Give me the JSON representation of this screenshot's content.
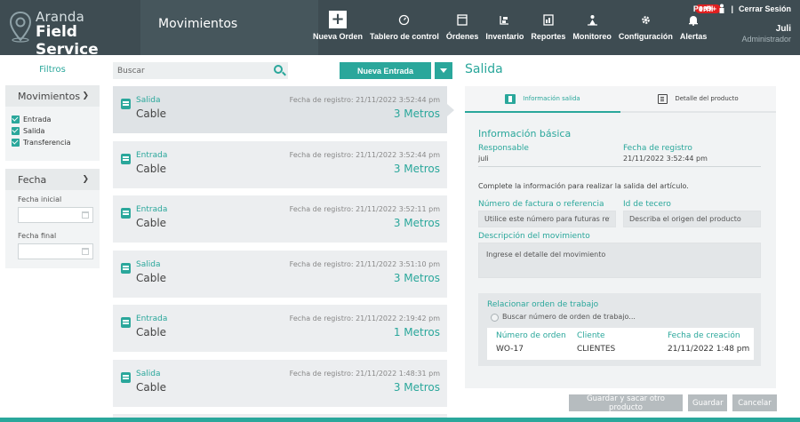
{
  "brand": {
    "line1": "Aranda",
    "line2": "Field Service",
    "accent": "#2aa79b",
    "header_bg": "#3e4c52"
  },
  "module": {
    "title": "Movimientos"
  },
  "nav": [
    {
      "label": "Nueva Orden",
      "icon": "plus-icon"
    },
    {
      "label": "Tablero de control",
      "icon": "dashboard-icon"
    },
    {
      "label": "Órdenes",
      "icon": "orders-icon"
    },
    {
      "label": "Inventario",
      "icon": "inventory-icon"
    },
    {
      "label": "Reportes",
      "icon": "reports-icon"
    },
    {
      "label": "Monitoreo",
      "icon": "monitor-icon"
    },
    {
      "label": "Configuración",
      "icon": "gear-icon"
    },
    {
      "label": "Alertas",
      "icon": "bell-icon",
      "badge": "999+"
    }
  ],
  "user": {
    "profile_label": "Perfil",
    "logout_label": "Cerrar Sesión",
    "name": "Juli",
    "role": "Administrador"
  },
  "filters": {
    "title": "Filtros",
    "movements_label": "Movimientos",
    "options": [
      "Entrada",
      "Salida",
      "Transferencia"
    ],
    "date_label": "Fecha",
    "start_label": "Fecha inicial",
    "end_label": "Fecha final"
  },
  "search": {
    "placeholder": "Buscar"
  },
  "new_entry_label": "Nueva Entrada",
  "list": [
    {
      "type": "Salida",
      "name": "Cable",
      "date": "Fecha de registro: 21/11/2022 3:52:44 pm",
      "qty": "3 Metros"
    },
    {
      "type": "Entrada",
      "name": "Cable",
      "date": "Fecha de registro: 21/11/2022 3:52:44 pm",
      "qty": "3 Metros"
    },
    {
      "type": "Entrada",
      "name": "Cable",
      "date": "Fecha de registro: 21/11/2022 3:52:11 pm",
      "qty": "3 Metros"
    },
    {
      "type": "Salida",
      "name": "Cable",
      "date": "Fecha de registro: 21/11/2022 3:51:10 pm",
      "qty": "3 Metros"
    },
    {
      "type": "Entrada",
      "name": "Cable",
      "date": "Fecha de registro: 21/11/2022 2:19:42 pm",
      "qty": "1 Metros"
    },
    {
      "type": "Salida",
      "name": "Cable",
      "date": "Fecha de registro: 21/11/2022 1:48:31 pm",
      "qty": "3 Metros"
    }
  ],
  "detail": {
    "title": "Salida",
    "tabs": [
      "Información salida",
      "Detalle del producto"
    ],
    "section_title": "Información básica",
    "responsible_label": "Responsable",
    "responsible_value": "juli",
    "date_label": "Fecha de registro",
    "date_value": "21/11/2022 3:52:44 pm",
    "hint": "Complete la información para realizar la salida del artículo.",
    "invoice_label": "Número de factura o referencia",
    "invoice_placeholder": "Utilice este número para futuras referencias",
    "third_label": "Id de tecero",
    "third_placeholder": "Describa el origen del producto",
    "desc_label": "Descripción del movimiento",
    "desc_placeholder": "Ingrese el detalle del movimiento",
    "wo": {
      "title": "Relacionar orden de trabajo",
      "search": "Buscar número de orden de trabajo...",
      "headers": [
        "Número de orden",
        "Cliente",
        "Fecha de creación"
      ],
      "row": [
        "WO-17",
        "CLIENTES",
        "21/11/2022 1:48 pm"
      ]
    }
  },
  "footer": {
    "save_and_out": "Guardar y sacar otro producto",
    "save": "Guardar",
    "cancel": "Cancelar"
  }
}
